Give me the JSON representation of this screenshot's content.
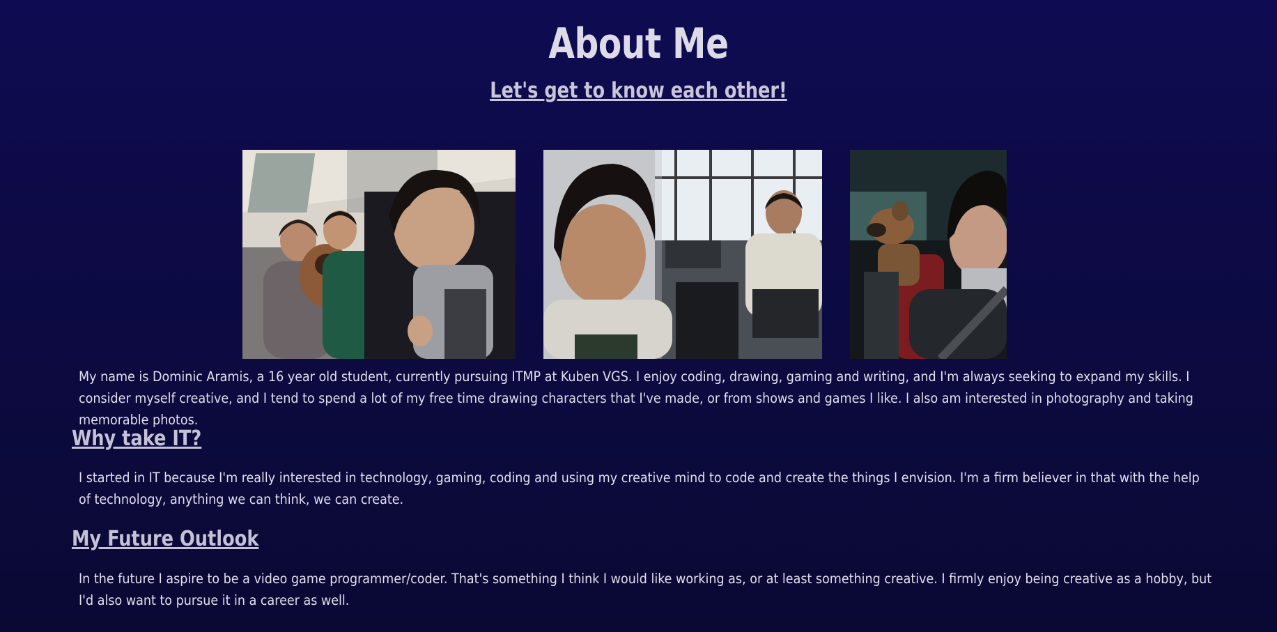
{
  "header": {
    "title": "About Me",
    "subtitle": "Let's get to know each other!"
  },
  "photos": [
    {
      "name": "photo-family-selfie"
    },
    {
      "name": "photo-classroom-selfie"
    },
    {
      "name": "photo-car-selfie-with-dog"
    }
  ],
  "intro": {
    "text": "My name is Dominic Aramis, a 16 year old student, currently pursuing ITMP at Kuben VGS. I enjoy coding, drawing, gaming and writing, and I'm always seeking to expand my skills. I consider myself creative, and I tend to spend a lot of my free time drawing characters that I've made, or from shows and games I like. I also am interested in photography and taking memorable photos."
  },
  "sections": [
    {
      "heading": "Why take IT?",
      "text": "I started in IT because I'm really interested in technology, gaming, coding and using my creative mind to code and create the things I envision. I'm a firm believer in that with the help of technology, anything we can think, we can create."
    },
    {
      "heading": "My Future Outlook",
      "text": "In the future I aspire to be a video game programmer/coder. That's something I think I would like working as, or at least something creative. I firmly enjoy being creative as a hobby, but I'd also want to pursue it in a career as well."
    }
  ],
  "colors": {
    "background": "#0e0b4a",
    "text": "#e2dfee",
    "heading": "#c5c2d8"
  }
}
